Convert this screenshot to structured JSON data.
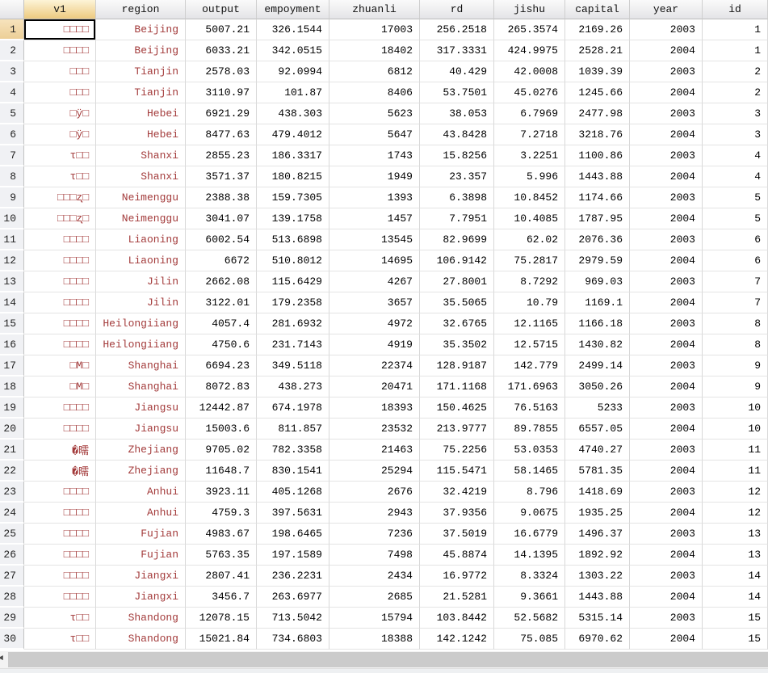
{
  "app": {
    "name": "data-editor"
  },
  "colors": {
    "string_text": "#a33b3b",
    "number_text": "#000000",
    "header_top": "#fafafa",
    "header_bottom": "#e4e4e7",
    "selected_header_top": "#fdf4d7",
    "selected_header_bottom": "#edca80",
    "selected_gutter_top": "#f7e3bd",
    "selected_gutter_bottom": "#eccf97",
    "gutter_bg": "#f0f1f4",
    "grid_line": "#d8d8d8",
    "scrollbar_thumb": "#cbcbcb"
  },
  "selection": {
    "row_index": 0,
    "column": "v1"
  },
  "scrollbar": {
    "orientation": "horizontal",
    "arrow_left_icon": "◄"
  },
  "table": {
    "columns": [
      {
        "key": "v1",
        "label": "v1",
        "type": "string"
      },
      {
        "key": "region",
        "label": "region",
        "type": "string"
      },
      {
        "key": "output",
        "label": "output",
        "type": "number"
      },
      {
        "key": "empoyment",
        "label": "empoyment",
        "type": "number"
      },
      {
        "key": "zhuanli",
        "label": "zhuanli",
        "type": "number"
      },
      {
        "key": "rd",
        "label": "rd",
        "type": "number"
      },
      {
        "key": "jishu",
        "label": "jishu",
        "type": "number"
      },
      {
        "key": "capital",
        "label": "capital",
        "type": "number"
      },
      {
        "key": "year",
        "label": "year",
        "type": "number"
      },
      {
        "key": "id",
        "label": "id",
        "type": "number"
      }
    ],
    "rows": [
      [
        "□□□□",
        "Beijing",
        "5007.21",
        "326.1544",
        "17003",
        "256.2518",
        "265.3574",
        "2169.26",
        "2003",
        "1"
      ],
      [
        "□□□□",
        "Beijing",
        "6033.21",
        "342.0515",
        "18402",
        "317.3331",
        "424.9975",
        "2528.21",
        "2004",
        "1"
      ],
      [
        "□□□",
        "Tianjin",
        "2578.03",
        "92.0994",
        "6812",
        "40.429",
        "42.0008",
        "1039.39",
        "2003",
        "2"
      ],
      [
        "□□□",
        "Tianjin",
        "3110.97",
        "101.87",
        "8406",
        "53.7501",
        "45.0276",
        "1245.66",
        "2004",
        "2"
      ],
      [
        "□ÿ□",
        "Hebei",
        "6921.29",
        "438.303",
        "5623",
        "38.053",
        "6.7969",
        "2477.98",
        "2003",
        "3"
      ],
      [
        "□ÿ□",
        "Hebei",
        "8477.63",
        "479.4012",
        "5647",
        "43.8428",
        "7.2718",
        "3218.76",
        "2004",
        "3"
      ],
      [
        "τ□□",
        "Shanxi",
        "2855.23",
        "186.3317",
        "1743",
        "15.8256",
        "3.2251",
        "1100.86",
        "2003",
        "4"
      ],
      [
        "τ□□",
        "Shanxi",
        "3571.37",
        "180.8215",
        "1949",
        "23.357",
        "5.996",
        "1443.88",
        "2004",
        "4"
      ],
      [
        "□□□ʐ□",
        "Neimenggu",
        "2388.38",
        "159.7305",
        "1393",
        "6.3898",
        "10.8452",
        "1174.66",
        "2003",
        "5"
      ],
      [
        "□□□ʐ□",
        "Neimenggu",
        "3041.07",
        "139.1758",
        "1457",
        "7.7951",
        "10.4085",
        "1787.95",
        "2004",
        "5"
      ],
      [
        "□□□□",
        "Liaoning",
        "6002.54",
        "513.6898",
        "13545",
        "82.9699",
        "62.02",
        "2076.36",
        "2003",
        "6"
      ],
      [
        "□□□□",
        "Liaoning",
        "6672",
        "510.8012",
        "14695",
        "106.9142",
        "75.2817",
        "2979.59",
        "2004",
        "6"
      ],
      [
        "□□□□",
        "Jilin",
        "2662.08",
        "115.6429",
        "4267",
        "27.8001",
        "8.7292",
        "969.03",
        "2003",
        "7"
      ],
      [
        "□□□□",
        "Jilin",
        "3122.01",
        "179.2358",
        "3657",
        "35.5065",
        "10.79",
        "1169.1",
        "2004",
        "7"
      ],
      [
        "□□□□",
        "Heilongiiang",
        "4057.4",
        "281.6932",
        "4972",
        "32.6765",
        "12.1165",
        "1166.18",
        "2003",
        "8"
      ],
      [
        "□□□□",
        "Heilongiiang",
        "4750.6",
        "231.7143",
        "4919",
        "35.3502",
        "12.5715",
        "1430.82",
        "2004",
        "8"
      ],
      [
        "□M□",
        "Shanghai",
        "6694.23",
        "349.5118",
        "22374",
        "128.9187",
        "142.779",
        "2499.14",
        "2003",
        "9"
      ],
      [
        "□M□",
        "Shanghai",
        "8072.83",
        "438.273",
        "20471",
        "171.1168",
        "171.6963",
        "3050.26",
        "2004",
        "9"
      ],
      [
        "□□□□",
        "Jiangsu",
        "12442.87",
        "674.1978",
        "18393",
        "150.4625",
        "76.5163",
        "5233",
        "2003",
        "10"
      ],
      [
        "□□□□",
        "Jiangsu",
        "15003.6",
        "811.857",
        "23532",
        "213.9777",
        "89.7855",
        "6557.05",
        "2004",
        "10"
      ],
      [
        "�曘",
        "Zhejiang",
        "9705.02",
        "782.3358",
        "21463",
        "75.2256",
        "53.0353",
        "4740.27",
        "2003",
        "11"
      ],
      [
        "�曘",
        "Zhejiang",
        "11648.7",
        "830.1541",
        "25294",
        "115.5471",
        "58.1465",
        "5781.35",
        "2004",
        "11"
      ],
      [
        "□□□□",
        "Anhui",
        "3923.11",
        "405.1268",
        "2676",
        "32.4219",
        "8.796",
        "1418.69",
        "2003",
        "12"
      ],
      [
        "□□□□",
        "Anhui",
        "4759.3",
        "397.5631",
        "2943",
        "37.9356",
        "9.0675",
        "1935.25",
        "2004",
        "12"
      ],
      [
        "□□□□",
        "Fujian",
        "4983.67",
        "198.6465",
        "7236",
        "37.5019",
        "16.6779",
        "1496.37",
        "2003",
        "13"
      ],
      [
        "□□□□",
        "Fujian",
        "5763.35",
        "197.1589",
        "7498",
        "45.8874",
        "14.1395",
        "1892.92",
        "2004",
        "13"
      ],
      [
        "□□□□",
        "Jiangxi",
        "2807.41",
        "236.2231",
        "2434",
        "16.9772",
        "8.3324",
        "1303.22",
        "2003",
        "14"
      ],
      [
        "□□□□",
        "Jiangxi",
        "3456.7",
        "263.6977",
        "2685",
        "21.5281",
        "9.3661",
        "1443.88",
        "2004",
        "14"
      ],
      [
        "τ□□",
        "Shandong",
        "12078.15",
        "713.5042",
        "15794",
        "103.8442",
        "52.5682",
        "5315.14",
        "2003",
        "15"
      ],
      [
        "τ□□",
        "Shandong",
        "15021.84",
        "734.6803",
        "18388",
        "142.1242",
        "75.085",
        "6970.62",
        "2004",
        "15"
      ]
    ]
  }
}
